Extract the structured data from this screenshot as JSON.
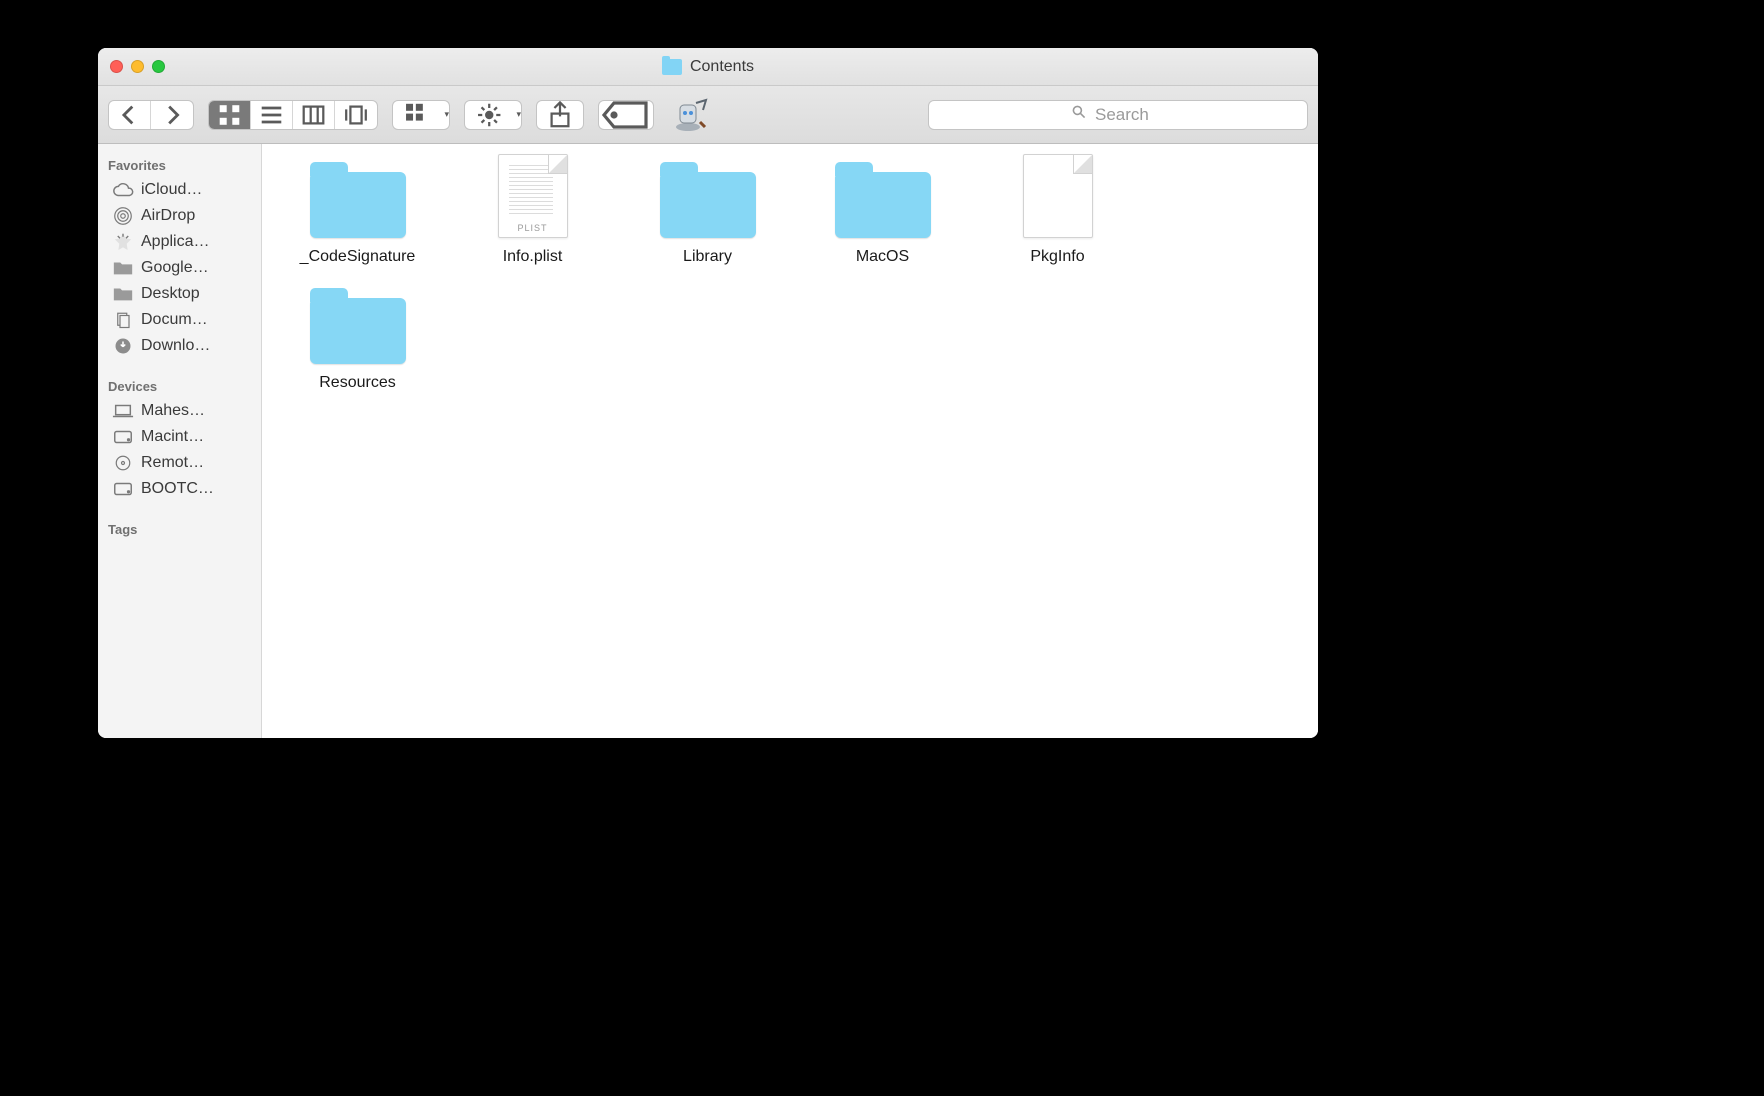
{
  "window": {
    "title": "Contents"
  },
  "toolbar": {
    "search_placeholder": "Search"
  },
  "sidebar": {
    "sections": [
      {
        "heading": "Favorites",
        "items": [
          {
            "label": "iCloud…",
            "icon": "cloud"
          },
          {
            "label": "AirDrop",
            "icon": "airdrop"
          },
          {
            "label": "Applica…",
            "icon": "applications"
          },
          {
            "label": "Google…",
            "icon": "folder"
          },
          {
            "label": "Desktop",
            "icon": "folder"
          },
          {
            "label": "Docum…",
            "icon": "documents"
          },
          {
            "label": "Downlo…",
            "icon": "download"
          }
        ]
      },
      {
        "heading": "Devices",
        "items": [
          {
            "label": "Mahes…",
            "icon": "laptop"
          },
          {
            "label": "Macint…",
            "icon": "hdd"
          },
          {
            "label": "Remot…",
            "icon": "disc"
          },
          {
            "label": "BOOTC…",
            "icon": "hdd"
          }
        ]
      },
      {
        "heading": "Tags",
        "items": []
      }
    ]
  },
  "items": [
    {
      "name": "_CodeSignature",
      "type": "folder"
    },
    {
      "name": "Info.plist",
      "type": "plist",
      "tag": "PLIST"
    },
    {
      "name": "Library",
      "type": "folder"
    },
    {
      "name": "MacOS",
      "type": "folder"
    },
    {
      "name": "PkgInfo",
      "type": "blank"
    },
    {
      "name": "Resources",
      "type": "folder"
    }
  ]
}
